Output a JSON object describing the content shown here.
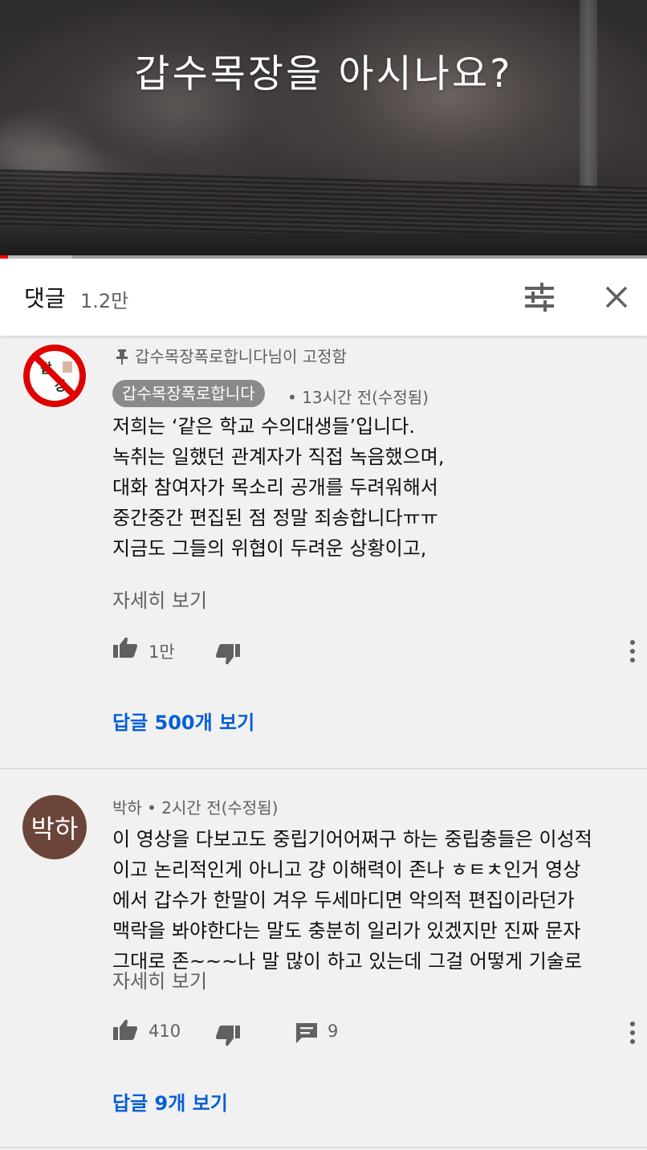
{
  "video": {
    "overlay_text": "갑수목장을 아시나요?",
    "progress_fraction": 0.012,
    "buffered_fraction": 0.112
  },
  "comments_panel": {
    "title": "댓글",
    "count": "1.2만"
  },
  "comments": [
    {
      "pinned_label": "갑수목장폭로합니다님이 고정함",
      "author": "갑수목장폭로합니다",
      "time": "• 13시간 전(수정됨)",
      "avatar_text": "갑수목장",
      "body": "저희는 ‘같은 학교 수의대생들’입니다.\n녹취는 일했던 관계자가 직접 녹음했으며,\n대화 참여자가 목소리 공개를 두려워해서\n중간중간 편집된 점 정말 죄송합니다ㅠㅠ\n지금도 그들의 위협이 두려운 상황이고,",
      "read_more": "자세히 보기",
      "likes": "1만",
      "replies_link": "답글 500개 보기"
    },
    {
      "author_time": "박하 • 2시간 전(수정됨)",
      "avatar_text": "박하",
      "avatar_color": "#6b4539",
      "body": "이 영상을 다보고도 중립기어어쩌구 하는 중립충들은 이성적\n이고 논리적인게 아니고 걍 이해력이 존나 ㅎㅌㅊ인거 영상\n에서 갑수가 한말이 겨우 두세마디면 악의적 편집이라던가\n맥락을 봐야한다는 말도 충분히 일리가 있겠지만 진짜 문자\n그대로 존~~~나 말 많이 하고 있는데 그걸 어떻게 기술로",
      "read_more": "자세히 보기",
      "likes": "410",
      "reply_count": "9",
      "replies_link": "답글 9개 보기"
    }
  ],
  "icons": {
    "pin": "pin-icon",
    "like": "thumb-up-icon",
    "dislike": "thumb-down-icon",
    "reply": "comment-icon",
    "more": "more-vert-icon",
    "filter": "sort-filter-icon",
    "close": "close-icon"
  },
  "colors": {
    "link_blue": "#065fd4",
    "progress_red": "#ff0000",
    "secondary_text": "#606060",
    "badge_bg": "#8a8a8a"
  }
}
